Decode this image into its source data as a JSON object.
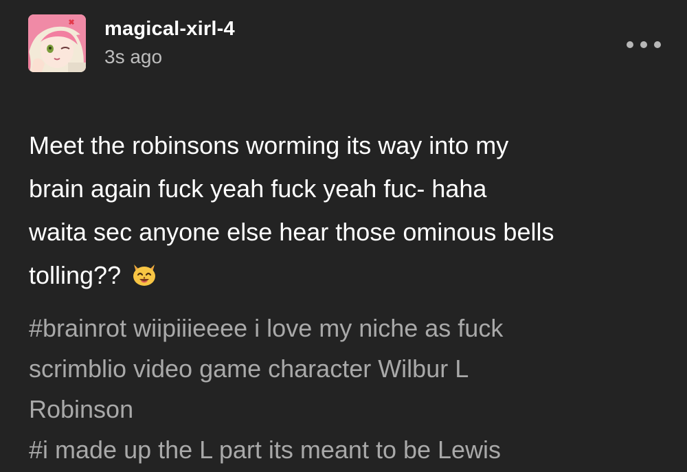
{
  "post": {
    "username": "magical-xirl-4",
    "timestamp": "3s ago",
    "menu_icon": "more-horizontal-icon",
    "body_lines": [
      "Meet the robinsons worming its way into my",
      "brain again fuck yeah fuck yeah fuc- haha",
      "waita sec anyone else hear those ominous bells",
      "tolling??"
    ],
    "emoji_icon": "smiling-cat-emoji-icon",
    "tag_lines": [
      "#brainrot wiipiiieeee i love my niche as fuck",
      "scrimblio video game character Wilbur L",
      "Robinson",
      "#i made up the L part its meant to be Lewis"
    ]
  },
  "colors": {
    "background": "#232323",
    "text": "#ffffff",
    "secondary_text": "#bdbdbd",
    "tags_text": "#a9a9a9"
  }
}
